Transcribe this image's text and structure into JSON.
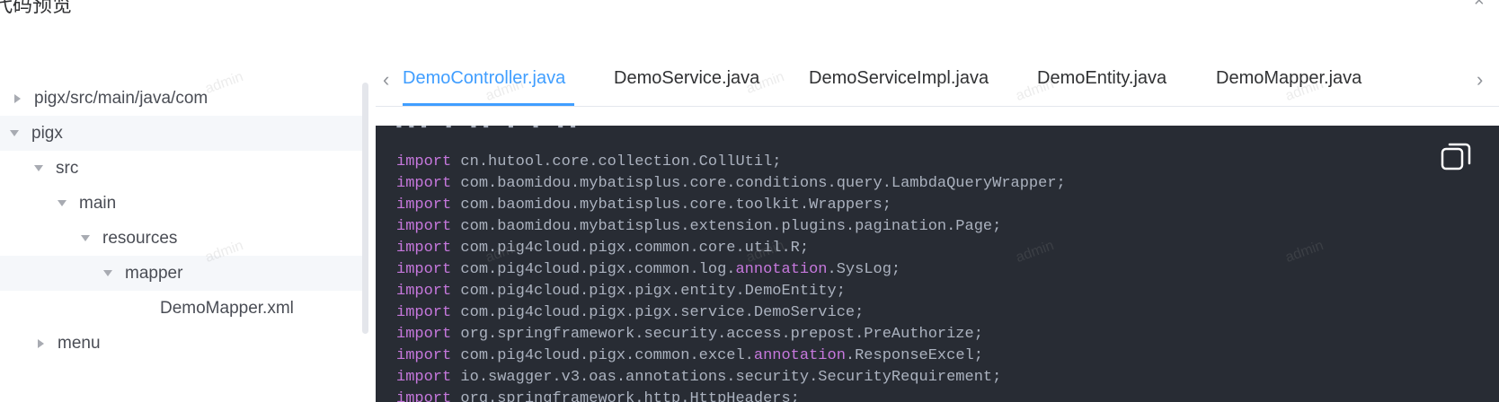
{
  "dialog": {
    "title": "代码预览",
    "close_symbol": "×"
  },
  "tree": {
    "nodes": [
      {
        "label": "pigx/src/main/java/com",
        "caret": "right",
        "highlight": false
      },
      {
        "label": "pigx",
        "caret": "down",
        "highlight": true
      },
      {
        "label": "src",
        "caret": "down",
        "highlight": false
      },
      {
        "label": "main",
        "caret": "down",
        "highlight": false
      },
      {
        "label": "resources",
        "caret": "down",
        "highlight": false
      },
      {
        "label": "mapper",
        "caret": "down",
        "highlight": true
      },
      {
        "label": "DemoMapper.xml",
        "caret": "none",
        "highlight": false
      },
      {
        "label": "menu",
        "caret": "right",
        "highlight": false
      }
    ]
  },
  "tabs": {
    "prev_symbol": "‹",
    "next_symbol": "›",
    "items": [
      {
        "label": "DemoController.java",
        "active": true
      },
      {
        "label": "DemoService.java",
        "active": false
      },
      {
        "label": "DemoServiceImpl.java",
        "active": false
      },
      {
        "label": "DemoEntity.java",
        "active": false
      },
      {
        "label": "DemoMapper.java",
        "active": false
      }
    ]
  },
  "code": {
    "keyword": "import",
    "lines": [
      {
        "kw": "import",
        "parts": [
          {
            "t": " cn.hutool.core.collection.CollUtil;"
          }
        ]
      },
      {
        "kw": "import",
        "parts": [
          {
            "t": " com.baomidou.mybatisplus.core.conditions.query.LambdaQueryWrapper;"
          }
        ]
      },
      {
        "kw": "import",
        "parts": [
          {
            "t": " com.baomidou.mybatisplus.core.toolkit.Wrappers;"
          }
        ]
      },
      {
        "kw": "import",
        "parts": [
          {
            "t": " com.baomidou.mybatisplus.extension.plugins.pagination.Page;"
          }
        ]
      },
      {
        "kw": "import",
        "parts": [
          {
            "t": " com.pig4cloud.pigx.common.core.util.R;"
          }
        ]
      },
      {
        "kw": "import",
        "parts": [
          {
            "t": " com.pig4cloud.pigx.common.log."
          },
          {
            "t": "annotation",
            "hl": true
          },
          {
            "t": ".SysLog;"
          }
        ]
      },
      {
        "kw": "import",
        "parts": [
          {
            "t": " com.pig4cloud.pigx.pigx.entity.DemoEntity;"
          }
        ]
      },
      {
        "kw": "import",
        "parts": [
          {
            "t": " com.pig4cloud.pigx.pigx.service.DemoService;"
          }
        ]
      },
      {
        "kw": "import",
        "parts": [
          {
            "t": " org.springframework.security.access.prepost.PreAuthorize;"
          }
        ]
      },
      {
        "kw": "import",
        "parts": [
          {
            "t": " com.pig4cloud.pigx.common.excel."
          },
          {
            "t": "annotation",
            "hl": true
          },
          {
            "t": ".ResponseExcel;"
          }
        ]
      },
      {
        "kw": "import",
        "parts": [
          {
            "t": " io.swagger.v3.oas.annotations.security.SecurityRequirement;"
          }
        ]
      },
      {
        "kw": "import",
        "parts": [
          {
            "t": " org.springframework.http.HttpHeaders;"
          }
        ]
      }
    ],
    "keyword_color": "#c678dd",
    "text_color": "#abb2bf",
    "background": "#282c34"
  },
  "watermark": {
    "text": "admin"
  },
  "colors": {
    "accent": "#409eff",
    "tree_highlight": "#f5f7fa"
  }
}
